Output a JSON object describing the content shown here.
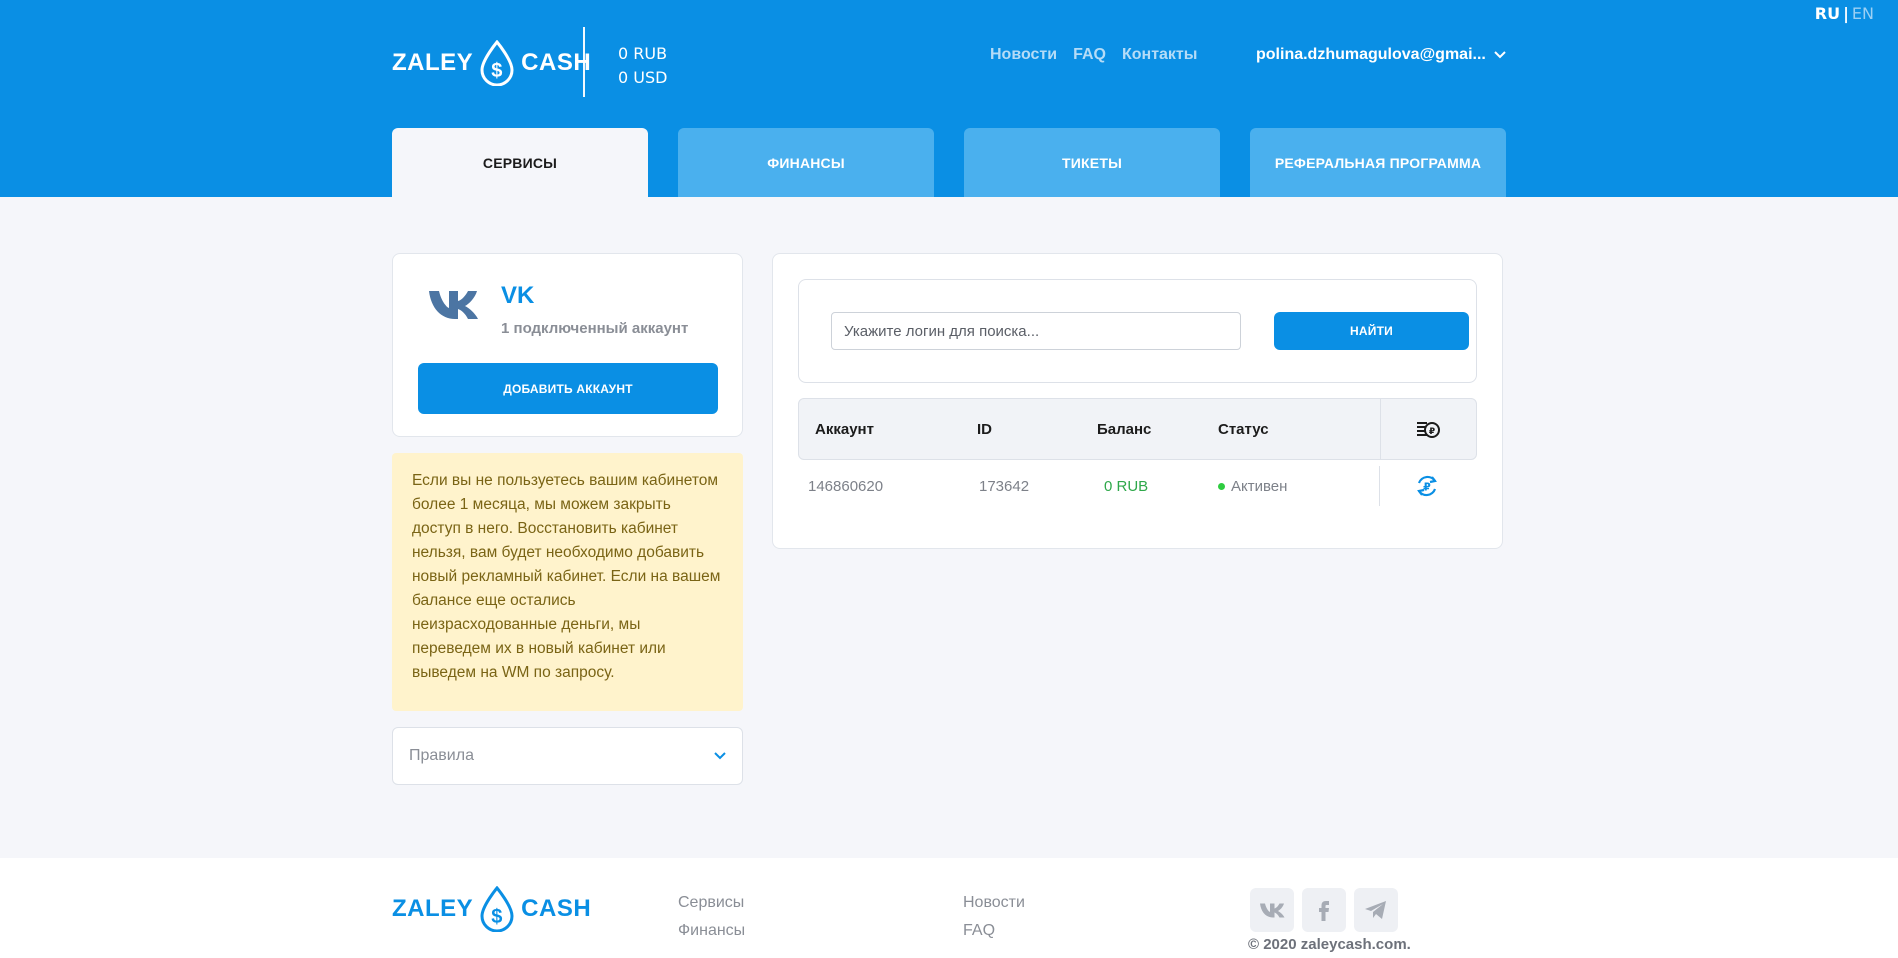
{
  "lang": {
    "ru": "RU",
    "separator": "|",
    "en": "EN"
  },
  "brand": {
    "left": "ZALEY",
    "right": "CASH"
  },
  "balances": {
    "rub": "0 RUB",
    "usd": "0 USD"
  },
  "topnav": [
    "Новости",
    "FAQ",
    "Контакты"
  ],
  "user": {
    "email": "polina.dzhumagulova@gmai..."
  },
  "tabs": [
    "СЕРВИСЫ",
    "ФИНАНСЫ",
    "ТИКЕТЫ",
    "РЕФЕРАЛЬНАЯ ПРОГРАММА"
  ],
  "service": {
    "name": "VK",
    "subtitle": "1 подключенный аккаунт",
    "add_button": "ДОБАВИТЬ АККАУНТ"
  },
  "notice": "Если вы не пользуетесь вашим кабинетом более 1 месяца, мы можем закрыть доступ в него. Восстановить кабинет нельзя, вам будет необходимо добавить новый рекламный кабинет. Если на вашем балансе еще остались неизрасходованные деньги, мы переведем их в новый кабинет или выведем на WM по запросу.",
  "rules": {
    "label": "Правила"
  },
  "search": {
    "placeholder": "Укажите логин для поиска...",
    "button": "НАЙТИ"
  },
  "table": {
    "headers": [
      "Аккаунт",
      "ID",
      "Баланс",
      "Статус"
    ],
    "rows": [
      {
        "account": "146860620",
        "id": "173642",
        "balance": "0 RUB",
        "status": "Активен"
      }
    ]
  },
  "footer": {
    "col1": [
      "Сервисы",
      "Финансы"
    ],
    "col2": [
      "Новости",
      "FAQ"
    ],
    "copyright": "© 2020 zaleycash.com."
  },
  "colors": {
    "brand": "#0a8fe4",
    "notice_bg": "#fff3cc",
    "active_status": "#2ecc40"
  },
  "icons": [
    "chevron-down-icon",
    "vk-icon",
    "money-stack-icon",
    "refresh-rub-icon",
    "facebook-icon",
    "telegram-icon"
  ]
}
